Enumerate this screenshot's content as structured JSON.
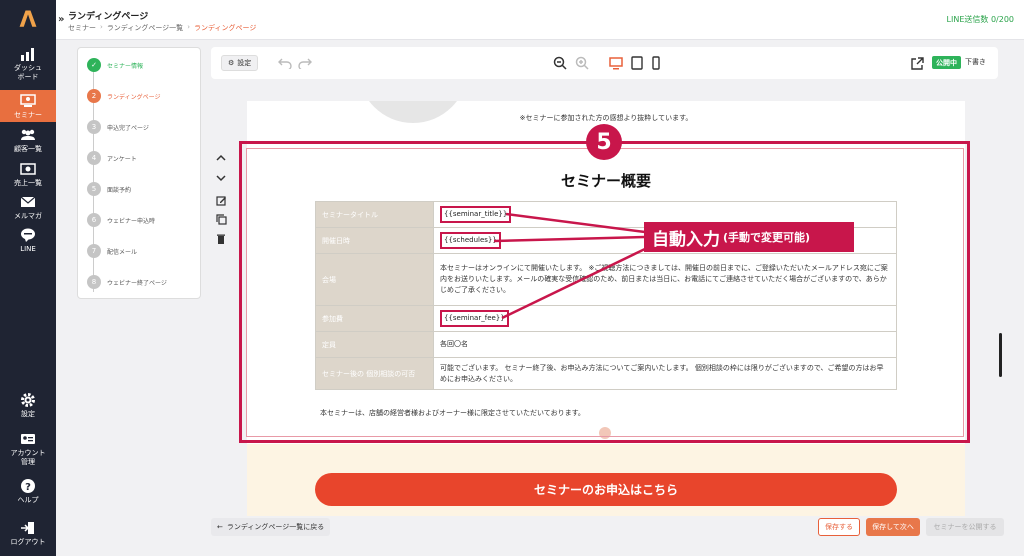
{
  "sidebar": {
    "logo": "Λ",
    "items": [
      {
        "label": "ダッシュ\nボード"
      },
      {
        "label": "セミナー"
      },
      {
        "label": "顧客一覧"
      },
      {
        "label": "売上一覧"
      },
      {
        "label": "メルマガ"
      },
      {
        "label": "LINE"
      },
      {
        "label": "設定"
      },
      {
        "label": "アカウント\n管理"
      },
      {
        "label": "ヘルプ"
      },
      {
        "label": "ログアウト"
      }
    ]
  },
  "header": {
    "title": "ランディングページ",
    "breadcrumb": [
      "セミナー",
      "ランディングページ一覧",
      "ランディングページ"
    ],
    "line_count_label": "LINE送信数",
    "line_count_value": "0/200"
  },
  "steps": [
    {
      "label": "セミナー情報",
      "num": "✓"
    },
    {
      "label": "ランディングページ",
      "num": "2"
    },
    {
      "label": "申込完了ページ",
      "num": "3"
    },
    {
      "label": "アンケート",
      "num": "4"
    },
    {
      "label": "面談予約",
      "num": "5"
    },
    {
      "label": "ウェビナー申込時",
      "num": "6"
    },
    {
      "label": "配信メール",
      "num": "7"
    },
    {
      "label": "ウェビナー終了ページ",
      "num": "8"
    }
  ],
  "toolbar": {
    "settings_label": "設定",
    "status_badge": "公開中",
    "draft_label": "下書き"
  },
  "canvas": {
    "quote_note": "※セミナーに参加された方の感想より抜粋しています。",
    "section_badge": "5",
    "section_title": "セミナー概要",
    "table": [
      {
        "header": "セミナータイトル",
        "value": "{{seminar_title}}"
      },
      {
        "header": "開催日時",
        "value": "{{schedules}}"
      },
      {
        "header": "会場",
        "value": "本セミナーはオンラインにて開催いたします。 ※ご視聴方法につきましては、開催日の前日までに、ご登録いただいたメールアドレス宛にご案内をお送りいたします。メールの確実な受信確認のため、前日または当日に、お電話にてご連絡させていただく場合がございますので、あらかじめご了承ください。"
      },
      {
        "header": "参加費",
        "value": "{{seminar_fee}}"
      },
      {
        "header": "定員",
        "value": "各回〇名"
      },
      {
        "header": "セミナー後の 個別相談の可否",
        "value": "可能でございます。 セミナー終了後、お申込み方法についてご案内いたします。 個別相談の枠には限りがございますので、ご希望の方はお早めにお申込みください。"
      }
    ],
    "footnote": "本セミナーは、店舗の経営者様およびオーナー様に限定させていただいております。",
    "cta_label": "セミナーのお申込はこちら"
  },
  "annotation": {
    "big": "自動入力",
    "small": "(手動で変更可能)"
  },
  "bottom": {
    "back_label": "ランディングページ一覧に戻る",
    "save_label": "保存する",
    "save_next_label": "保存して次へ",
    "publish_label": "セミナーを公開する"
  },
  "colors": {
    "accent": "#e8603a",
    "annotation": "#c8164b",
    "success": "#2eb35a",
    "sidebar": "#1f2433"
  }
}
